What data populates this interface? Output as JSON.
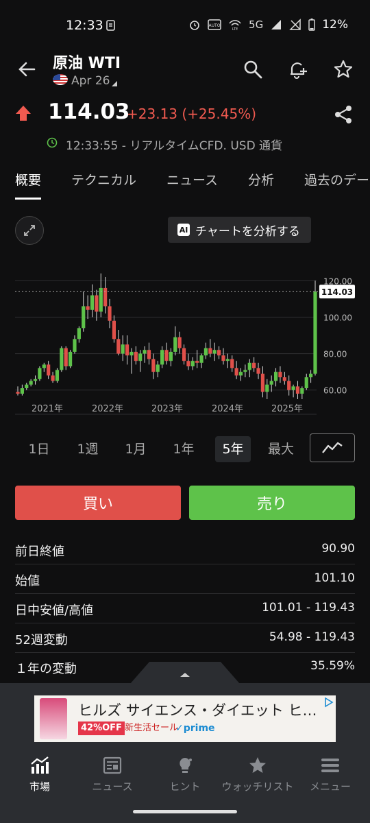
{
  "status_bar": {
    "time": "12:33",
    "network": "5G",
    "battery": "12%",
    "icons": [
      "notification-icon",
      "alarm-icon",
      "auto-hd-icon",
      "wifi-lte-icon",
      "signal-icon",
      "signal-off-icon",
      "battery-icon"
    ]
  },
  "header": {
    "title": "原油 WTI",
    "date": "Apr 26",
    "icons": [
      "back-arrow-icon",
      "search-icon",
      "alert-add-icon",
      "star-icon"
    ]
  },
  "quote": {
    "price": "114.03",
    "change": "+23.13 (+25.45%)",
    "realtime": "12:33:55 - リアルタイムCFD. USD 通貨",
    "up_color": "#f05a50"
  },
  "tabs": [
    {
      "label": "概要",
      "active": true
    },
    {
      "label": "テクニカル",
      "active": false
    },
    {
      "label": "ニュース",
      "active": false
    },
    {
      "label": "分析",
      "active": false
    },
    {
      "label": "過去のデー",
      "active": false
    }
  ],
  "chart_tools": {
    "ai_badge": "AI",
    "analyze_label": "チャートを分析する"
  },
  "chart_data": {
    "type": "candlestick",
    "x_labels": [
      "2021年",
      "2022年",
      "2023年",
      "2024年",
      "2025年"
    ],
    "y_ticks": [
      60.0,
      80.0,
      100.0,
      120.0
    ],
    "y_tick_labels": [
      "60.00",
      "80.00",
      "100.00",
      "120.00"
    ],
    "ylim": [
      55,
      125
    ],
    "current_price_label": "114.03",
    "current_price": 114.03,
    "up_color": "#5ec24a",
    "down_color": "#e0504a",
    "candles": [
      [
        59,
        62,
        57,
        58
      ],
      [
        58,
        63,
        57,
        61
      ],
      [
        61,
        64,
        60,
        63
      ],
      [
        63,
        66,
        62,
        65
      ],
      [
        65,
        68,
        63,
        66
      ],
      [
        66,
        73,
        65,
        72
      ],
      [
        72,
        75,
        70,
        74
      ],
      [
        74,
        76,
        66,
        68
      ],
      [
        68,
        70,
        64,
        65
      ],
      [
        65,
        72,
        64,
        71
      ],
      [
        71,
        84,
        70,
        83
      ],
      [
        83,
        84,
        71,
        73
      ],
      [
        73,
        82,
        72,
        81
      ],
      [
        81,
        90,
        80,
        88
      ],
      [
        88,
        95,
        86,
        94
      ],
      [
        94,
        114,
        92,
        106
      ],
      [
        106,
        112,
        99,
        104
      ],
      [
        104,
        118,
        100,
        112
      ],
      [
        112,
        115,
        98,
        103
      ],
      [
        103,
        124,
        100,
        116
      ],
      [
        116,
        122,
        102,
        106
      ],
      [
        106,
        110,
        94,
        98
      ],
      [
        98,
        101,
        86,
        88
      ],
      [
        88,
        93,
        79,
        80
      ],
      [
        80,
        90,
        76,
        85
      ],
      [
        85,
        90,
        74,
        79
      ],
      [
        79,
        83,
        69,
        81
      ],
      [
        81,
        84,
        74,
        76
      ],
      [
        76,
        82,
        70,
        80
      ],
      [
        80,
        84,
        75,
        82
      ],
      [
        82,
        86,
        74,
        77
      ],
      [
        77,
        80,
        66,
        70
      ],
      [
        70,
        76,
        67,
        74
      ],
      [
        74,
        84,
        72,
        82
      ],
      [
        82,
        86,
        74,
        76
      ],
      [
        76,
        83,
        73,
        81
      ],
      [
        81,
        95,
        79,
        89
      ],
      [
        89,
        92,
        80,
        83
      ],
      [
        83,
        85,
        74,
        76
      ],
      [
        76,
        80,
        71,
        73
      ],
      [
        73,
        78,
        71,
        76
      ],
      [
        76,
        82,
        72,
        75
      ],
      [
        75,
        80,
        72,
        79
      ],
      [
        79,
        86,
        77,
        83
      ],
      [
        83,
        88,
        78,
        80
      ],
      [
        80,
        86,
        76,
        82
      ],
      [
        82,
        84,
        77,
        79
      ],
      [
        79,
        83,
        74,
        76
      ],
      [
        76,
        80,
        72,
        77
      ],
      [
        77,
        79,
        70,
        72
      ],
      [
        72,
        76,
        66,
        68
      ],
      [
        68,
        72,
        65,
        70
      ],
      [
        70,
        74,
        67,
        71
      ],
      [
        71,
        77,
        67,
        75
      ],
      [
        75,
        78,
        70,
        72
      ],
      [
        72,
        75,
        66,
        69
      ],
      [
        69,
        73,
        56,
        59
      ],
      [
        59,
        66,
        55,
        63
      ],
      [
        63,
        68,
        59,
        65
      ],
      [
        65,
        72,
        62,
        70
      ],
      [
        70,
        73,
        64,
        67
      ],
      [
        67,
        70,
        63,
        65
      ],
      [
        65,
        68,
        57,
        60
      ],
      [
        60,
        63,
        56,
        62
      ],
      [
        62,
        65,
        55,
        58
      ],
      [
        58,
        62,
        55,
        61
      ],
      [
        61,
        69,
        60,
        67
      ],
      [
        67,
        71,
        64,
        69
      ],
      [
        69,
        120,
        68,
        114
      ]
    ]
  },
  "ranges": [
    {
      "label": "1日",
      "active": false
    },
    {
      "label": "1週",
      "active": false
    },
    {
      "label": "1月",
      "active": false
    },
    {
      "label": "1年",
      "active": false
    },
    {
      "label": "5年",
      "active": true
    },
    {
      "label": "最大",
      "active": false
    }
  ],
  "actions": {
    "buy": "買い",
    "sell": "売り"
  },
  "stats": [
    {
      "label": "前日終値",
      "value": "90.90"
    },
    {
      "label": "始値",
      "value": "101.10"
    },
    {
      "label": "日中安値/高値",
      "value": "101.01 - 119.43"
    },
    {
      "label": "52週変動",
      "value": "54.98 - 119.43"
    },
    {
      "label": "１年の変動",
      "value": "35.59%"
    }
  ],
  "ad": {
    "title": "ヒルズ サイエンス・ダイエット ヒ…",
    "badge": "42%OFF",
    "sale": "新生活セール",
    "prime": "✓prime"
  },
  "nav": [
    {
      "label": "市場",
      "icon": "market-chart-icon",
      "active": true
    },
    {
      "label": "ニュース",
      "icon": "news-icon",
      "active": false
    },
    {
      "label": "ヒント",
      "icon": "lightbulb-icon",
      "active": false
    },
    {
      "label": "ウォッチリスト",
      "icon": "star-icon",
      "active": false
    },
    {
      "label": "メニュー",
      "icon": "menu-icon",
      "active": false
    }
  ]
}
